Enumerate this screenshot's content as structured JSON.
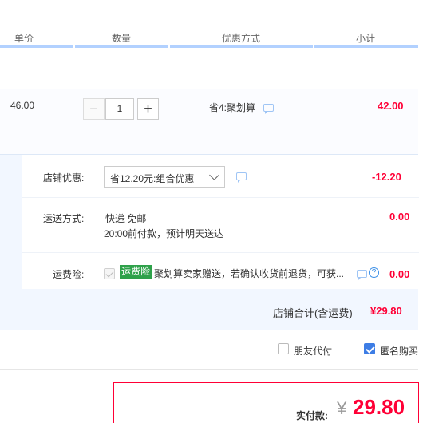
{
  "header": {
    "col_price": "单价",
    "col_qty": "数量",
    "col_promo": "优惠方式",
    "col_subtotal": "小计"
  },
  "item": {
    "unit_price": "46.00",
    "qty_minus": "−",
    "qty_value": "1",
    "qty_plus": "+",
    "promo": "省4:聚划算",
    "subtotal": "42.00"
  },
  "shop": {
    "coupon_label": "店铺优惠:",
    "coupon_selected": "省12.20元:组合优惠",
    "coupon_amount": "-12.20",
    "shipping_label": "运送方式:",
    "shipping_method": "快递 免邮",
    "shipping_note": "20:00前付款，预计明天送达",
    "shipping_amount": "0.00",
    "insurance_label": "运费险:",
    "insurance_badge": "运费险",
    "insurance_text": "聚划算卖家赠送，若确认收货前退货，可获...",
    "insurance_amount": "0.00",
    "total_label": "店铺合计(含运费)",
    "total_value": "¥29.80"
  },
  "options": {
    "friend_pay_label": "朋友代付",
    "friend_pay_checked": false,
    "anonymous_label": "匿名购买",
    "anonymous_checked": true
  },
  "payment": {
    "label": "实付款:",
    "currency": "¥",
    "amount": "29.80"
  },
  "colors": {
    "accent_red": "#ff0036",
    "accent_blue": "#3d7de5",
    "header_line": "#b2d1ff",
    "insurance_green": "#2ea14a"
  },
  "icons": [
    "chat-icon",
    "help-icon",
    "chevron-down-icon",
    "checkbox-icon"
  ]
}
